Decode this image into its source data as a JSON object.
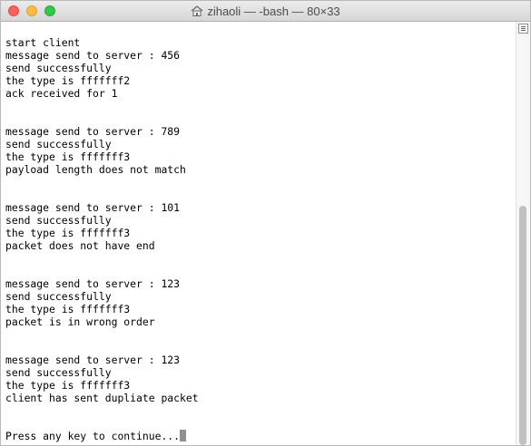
{
  "window": {
    "title": "zihaoli — -bash — 80×33",
    "title_icon": "home-icon"
  },
  "terminal": {
    "lines": [
      "start client",
      "message send to server : 456",
      "send successfully",
      "the type is fffffff2",
      "ack received for 1",
      "",
      "",
      "message send to server : 789",
      "send successfully",
      "the type is fffffff3",
      "payload length does not match",
      "",
      "",
      "message send to server : 101",
      "send successfully",
      "the type is fffffff3",
      "packet does not have end",
      "",
      "",
      "message send to server : 123",
      "send successfully",
      "the type is fffffff3",
      "packet is in wrong order",
      "",
      "",
      "message send to server : 123",
      "send successfully",
      "the type is fffffff3",
      "client has sent dupliate packet",
      "",
      "",
      "Press any key to continue..."
    ]
  },
  "colors": {
    "close": "#fc605c",
    "minimize": "#fdbc40",
    "zoom": "#34c84a"
  }
}
